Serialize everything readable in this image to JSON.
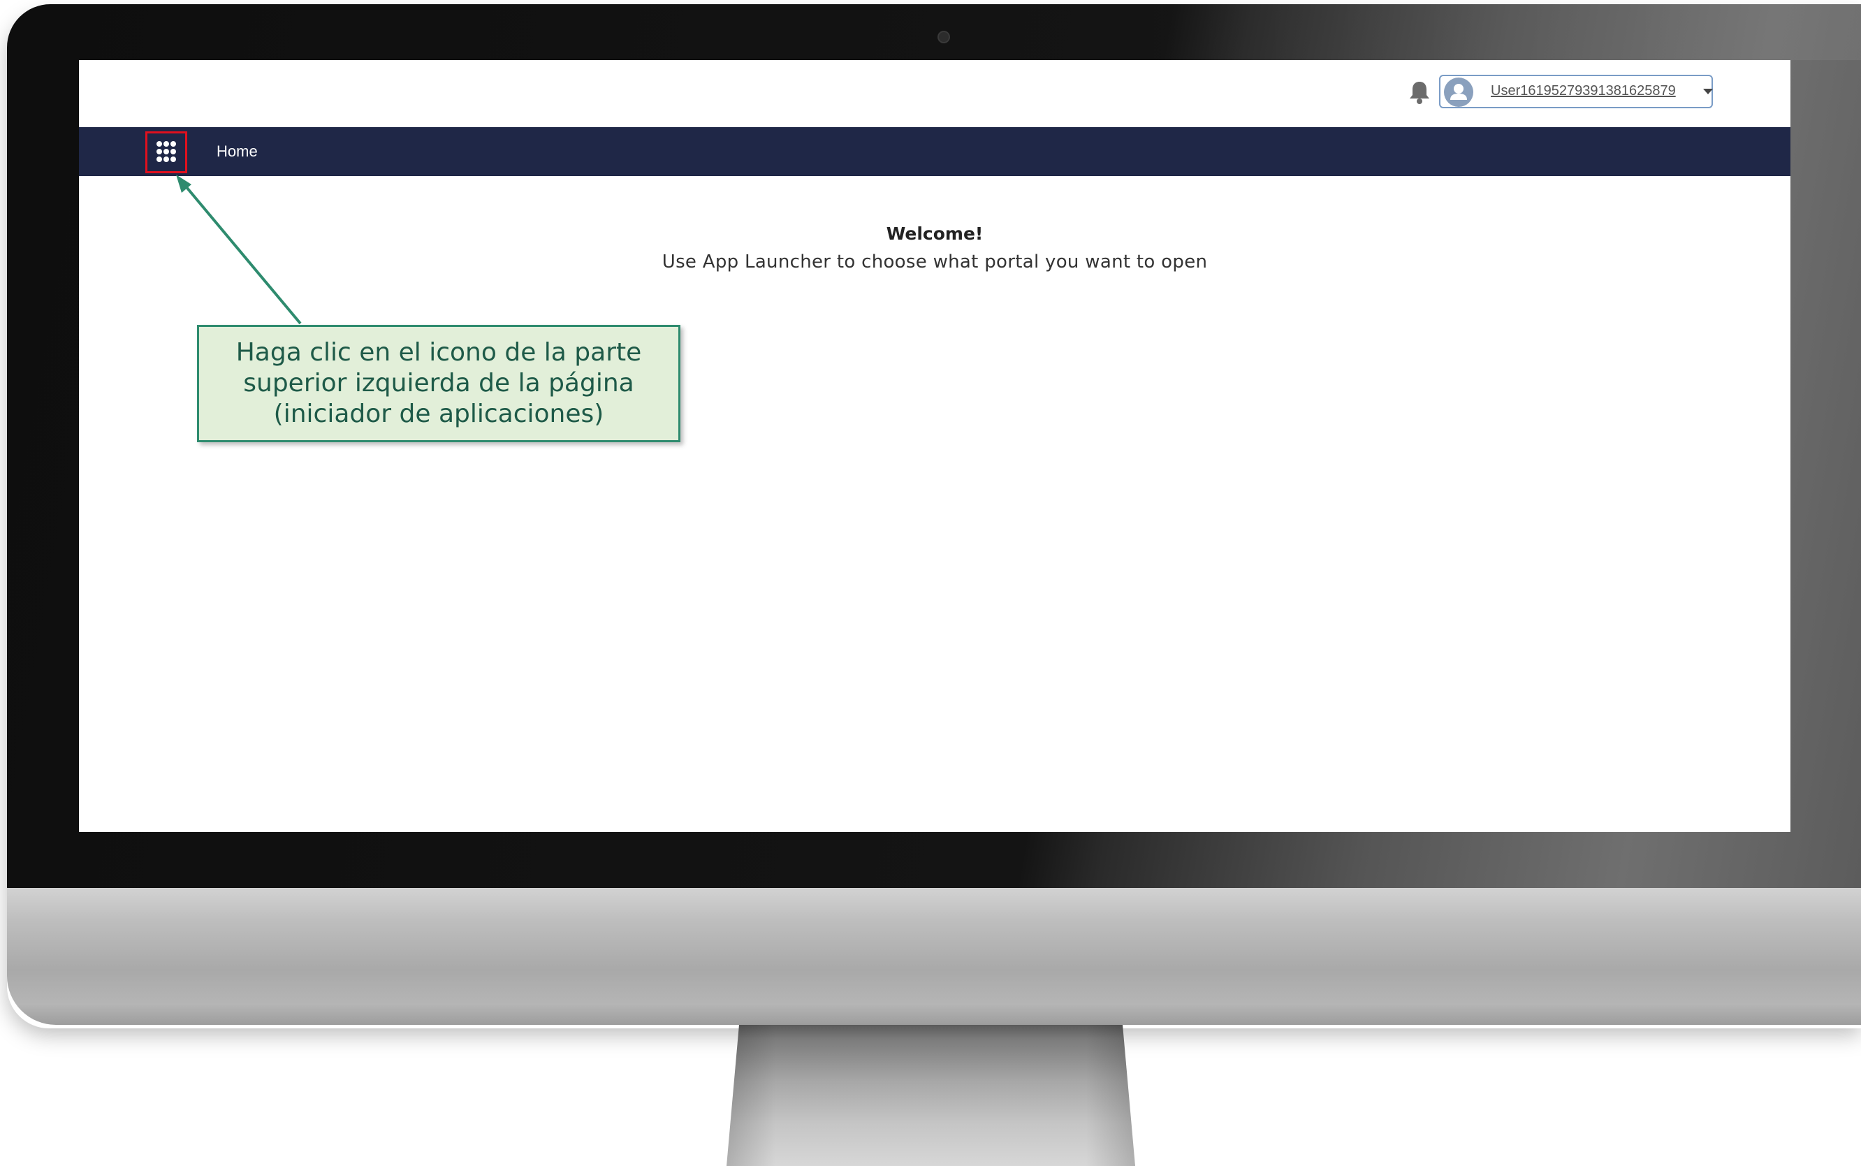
{
  "topbar": {
    "notifications_icon": "bell-icon",
    "user_menu": {
      "avatar_icon": "user-avatar-icon",
      "username": "User16195279391381625879",
      "caret_icon": "chevron-down-icon"
    }
  },
  "navbar": {
    "app_launcher_icon": "app-launcher-grid-icon",
    "home_label": "Home",
    "background_color": "#1f2747",
    "highlight_color": "#e0101e"
  },
  "main": {
    "welcome_title": "Welcome!",
    "welcome_text": "Use App Launcher to choose what portal you want to open"
  },
  "annotation": {
    "callout_text": "Haga clic en el icono de la parte\nsuperior izquierda de la página\n(iniciador de aplicaciones)",
    "callout_bg": "#e2efd9",
    "callout_border": "#2e8b6e"
  }
}
